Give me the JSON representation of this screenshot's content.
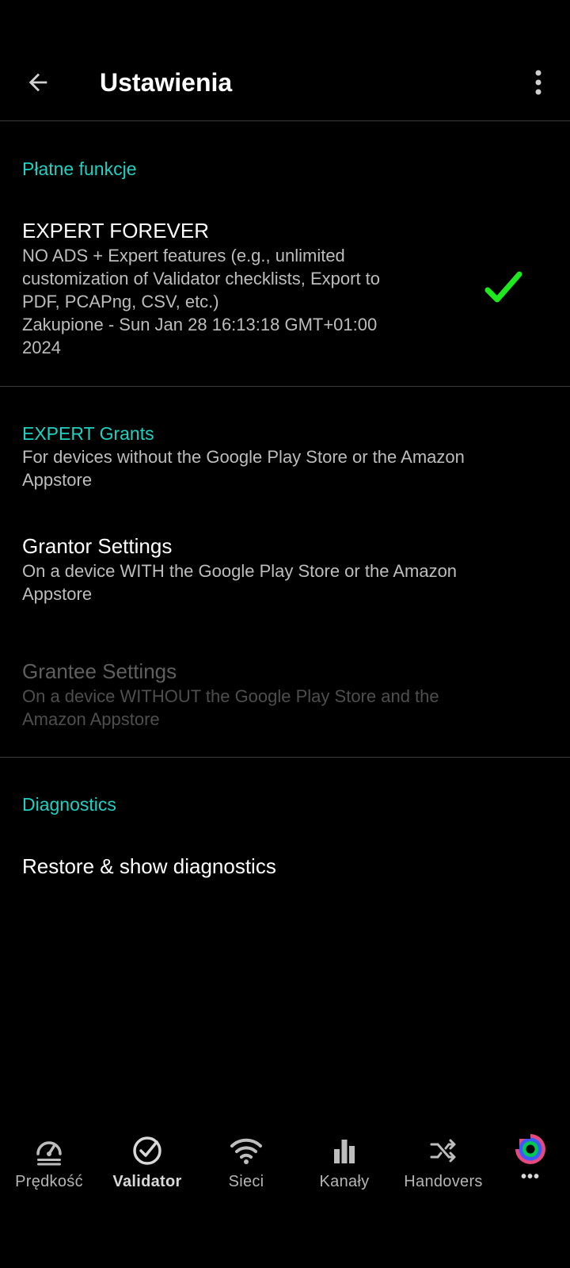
{
  "appbar": {
    "title": "Ustawienia",
    "back_icon": "arrow-back-icon",
    "more_icon": "more-vert-icon"
  },
  "sections": {
    "paid": {
      "header": "Płatne funkcje",
      "expert_forever": {
        "title": "EXPERT FOREVER",
        "summary_line1": "NO ADS + Expert features (e.g., unlimited",
        "summary_line2": "customization of Validator checklists, Export to",
        "summary_line3": "PDF, PCAPng, CSV, etc.)",
        "summary_line4": "Zakupione - Sun Jan 28 16:13:18 GMT+01:00",
        "summary_line5": "2024",
        "status_icon": "check-icon",
        "status_color": "#1ee81e"
      }
    },
    "grants": {
      "header": "EXPERT Grants",
      "header_summary_line1": "For devices without the Google Play Store or the Amazon",
      "header_summary_line2": "Appstore",
      "grantor": {
        "title": "Grantor Settings",
        "summary_line1": "On a device WITH the Google Play Store or the Amazon",
        "summary_line2": "Appstore"
      },
      "grantee": {
        "title": "Grantee Settings",
        "summary_line1": "On a device WITHOUT the Google Play Store and the",
        "summary_line2": "Amazon Appstore"
      }
    },
    "diagnostics": {
      "header": "Diagnostics",
      "restore": {
        "title": "Restore & show diagnostics"
      }
    }
  },
  "bottom_nav": {
    "items": [
      {
        "label": "Prędkość",
        "icon": "speedometer-icon"
      },
      {
        "label": "Validator",
        "icon": "check-circle-icon",
        "active": true
      },
      {
        "label": "Sieci",
        "icon": "wifi-icon"
      },
      {
        "label": "Kanały",
        "icon": "bar-chart-icon"
      },
      {
        "label": "Handovers",
        "icon": "shuffle-icon"
      },
      {
        "label": "•••",
        "icon": "app-logo-icon"
      }
    ]
  },
  "colors": {
    "accent": "#1fd1c1",
    "background": "#000000"
  }
}
